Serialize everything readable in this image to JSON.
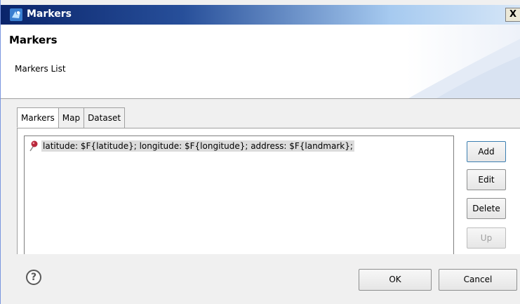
{
  "window": {
    "title": "Markers",
    "close_label": "X"
  },
  "header": {
    "title": "Markers",
    "subtitle": "Markers List"
  },
  "tabs": [
    {
      "label": "Markers",
      "active": true
    },
    {
      "label": "Map",
      "active": false
    },
    {
      "label": "Dataset",
      "active": false
    }
  ],
  "markers_list": {
    "items": [
      {
        "label": "latitude: $F{latitude}; longitude: $F{longitude}; address: $F{landmark};",
        "icon": "marker-pin-icon",
        "selected": true
      }
    ]
  },
  "side_buttons": {
    "add": "Add",
    "edit": "Edit",
    "delete": "Delete",
    "up": "Up"
  },
  "footer": {
    "help": "?",
    "ok": "OK",
    "cancel": "Cancel"
  },
  "colors": {
    "titlebar_start": "#0a246a",
    "titlebar_end": "#d6e6f7",
    "selection_bg": "#dcdcdc"
  }
}
